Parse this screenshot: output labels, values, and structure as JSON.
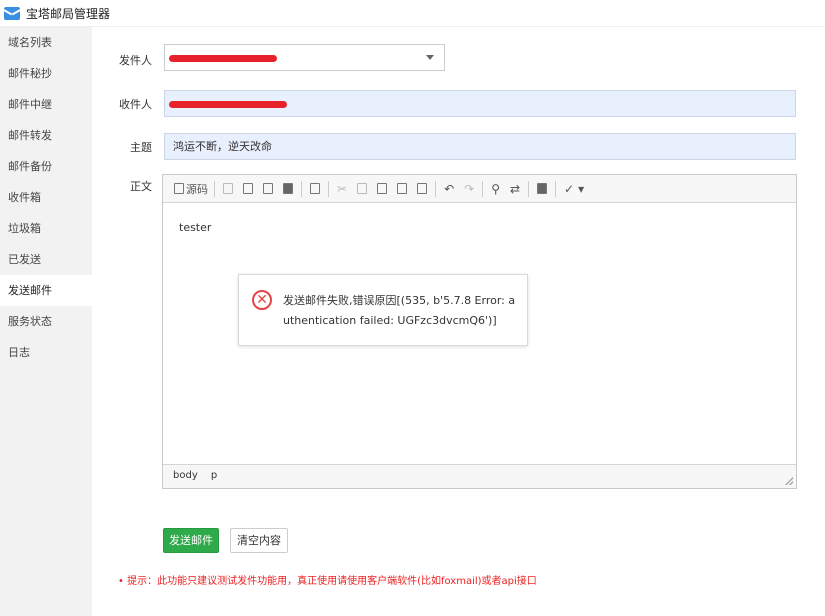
{
  "window": {
    "title": "宝塔邮局管理器"
  },
  "sidebar": {
    "items": [
      {
        "label": "域名列表"
      },
      {
        "label": "邮件秘抄"
      },
      {
        "label": "邮件中继"
      },
      {
        "label": "邮件转发"
      },
      {
        "label": "邮件备份"
      },
      {
        "label": "收件箱"
      },
      {
        "label": "垃圾箱"
      },
      {
        "label": "已发送"
      },
      {
        "label": "发送邮件"
      },
      {
        "label": "服务状态"
      },
      {
        "label": "日志"
      }
    ],
    "active_index": 8
  },
  "form": {
    "sender_label": "发件人",
    "recipient_label": "收件人",
    "subject_label": "主题",
    "subject_value": "鸿运不断，逆天改命",
    "body_label": "正文"
  },
  "editor": {
    "source_label": "源码",
    "content": "tester",
    "path": [
      "body",
      "p"
    ]
  },
  "dialog": {
    "message": "发送邮件失败,错误原因[(535, b'5.7.8 Error: authentication failed: UGFzc3dvcmQ6')]"
  },
  "buttons": {
    "send": "发送邮件",
    "clear": "清空内容"
  },
  "tip": "• 提示：此功能只建议测试发件功能用，真正使用请使用客户端软件(比如foxmail)或者api接口",
  "colors": {
    "accent": "#2eaa4a",
    "error": "#e34545",
    "tip": "#ee2222",
    "input_highlight": "#e8effd"
  }
}
